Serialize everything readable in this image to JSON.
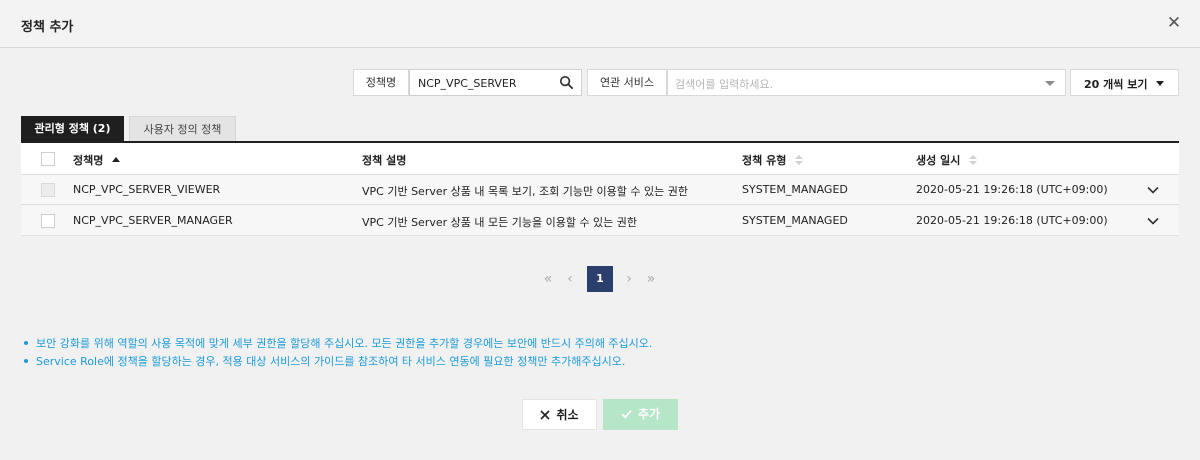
{
  "dialog": {
    "title": "정책 추가",
    "close_glyph": "✕"
  },
  "filters": {
    "policy_name_label": "정책명",
    "policy_name_value": "NCP_VPC_SERVER",
    "service_label": "연관 서비스",
    "service_placeholder": "검색어를 입력하세요.",
    "page_size": "20 개씩 보기"
  },
  "tabs": [
    {
      "label": "관리형 정책 (2)",
      "active": true
    },
    {
      "label": "사용자 정의 정책",
      "active": false
    }
  ],
  "table": {
    "columns": [
      "정책명",
      "정책 설명",
      "정책 유형",
      "생성 일시"
    ],
    "rows": [
      {
        "name": "NCP_VPC_SERVER_VIEWER",
        "description": "VPC 기반 Server 상품 내 목록 보기, 조회 기능만 이용할 수 있는 권한",
        "type": "SYSTEM_MANAGED",
        "created": "2020-05-21 19:26:18 (UTC+09:00)"
      },
      {
        "name": "NCP_VPC_SERVER_MANAGER",
        "description": "VPC 기반 Server 상품 내 모든 기능을 이용할 수 있는 권한",
        "type": "SYSTEM_MANAGED",
        "created": "2020-05-21 19:26:18 (UTC+09:00)"
      }
    ]
  },
  "pagination": {
    "first": "«",
    "prev": "‹",
    "current": "1",
    "next": "›",
    "last": "»"
  },
  "notes": [
    "보안 강화를 위해 역할의 사용 목적에 맞게 세부 권한을 할당해 주십시오. 모든 권한을 추가할 경우에는 보안에 반드시 주의해 주십시오.",
    "Service Role에 정책을 할당하는 경우, 적용 대상 서비스의 가이드를 참조하여 타 서비스 연동에 필요한 정책만 추가해주십시오."
  ],
  "buttons": {
    "cancel": "취소",
    "add": "추가"
  },
  "colors": {
    "accent": "#1c9bd8",
    "pagination_active": "#2c3e6b",
    "add_disabled": "#b4e6c7"
  }
}
